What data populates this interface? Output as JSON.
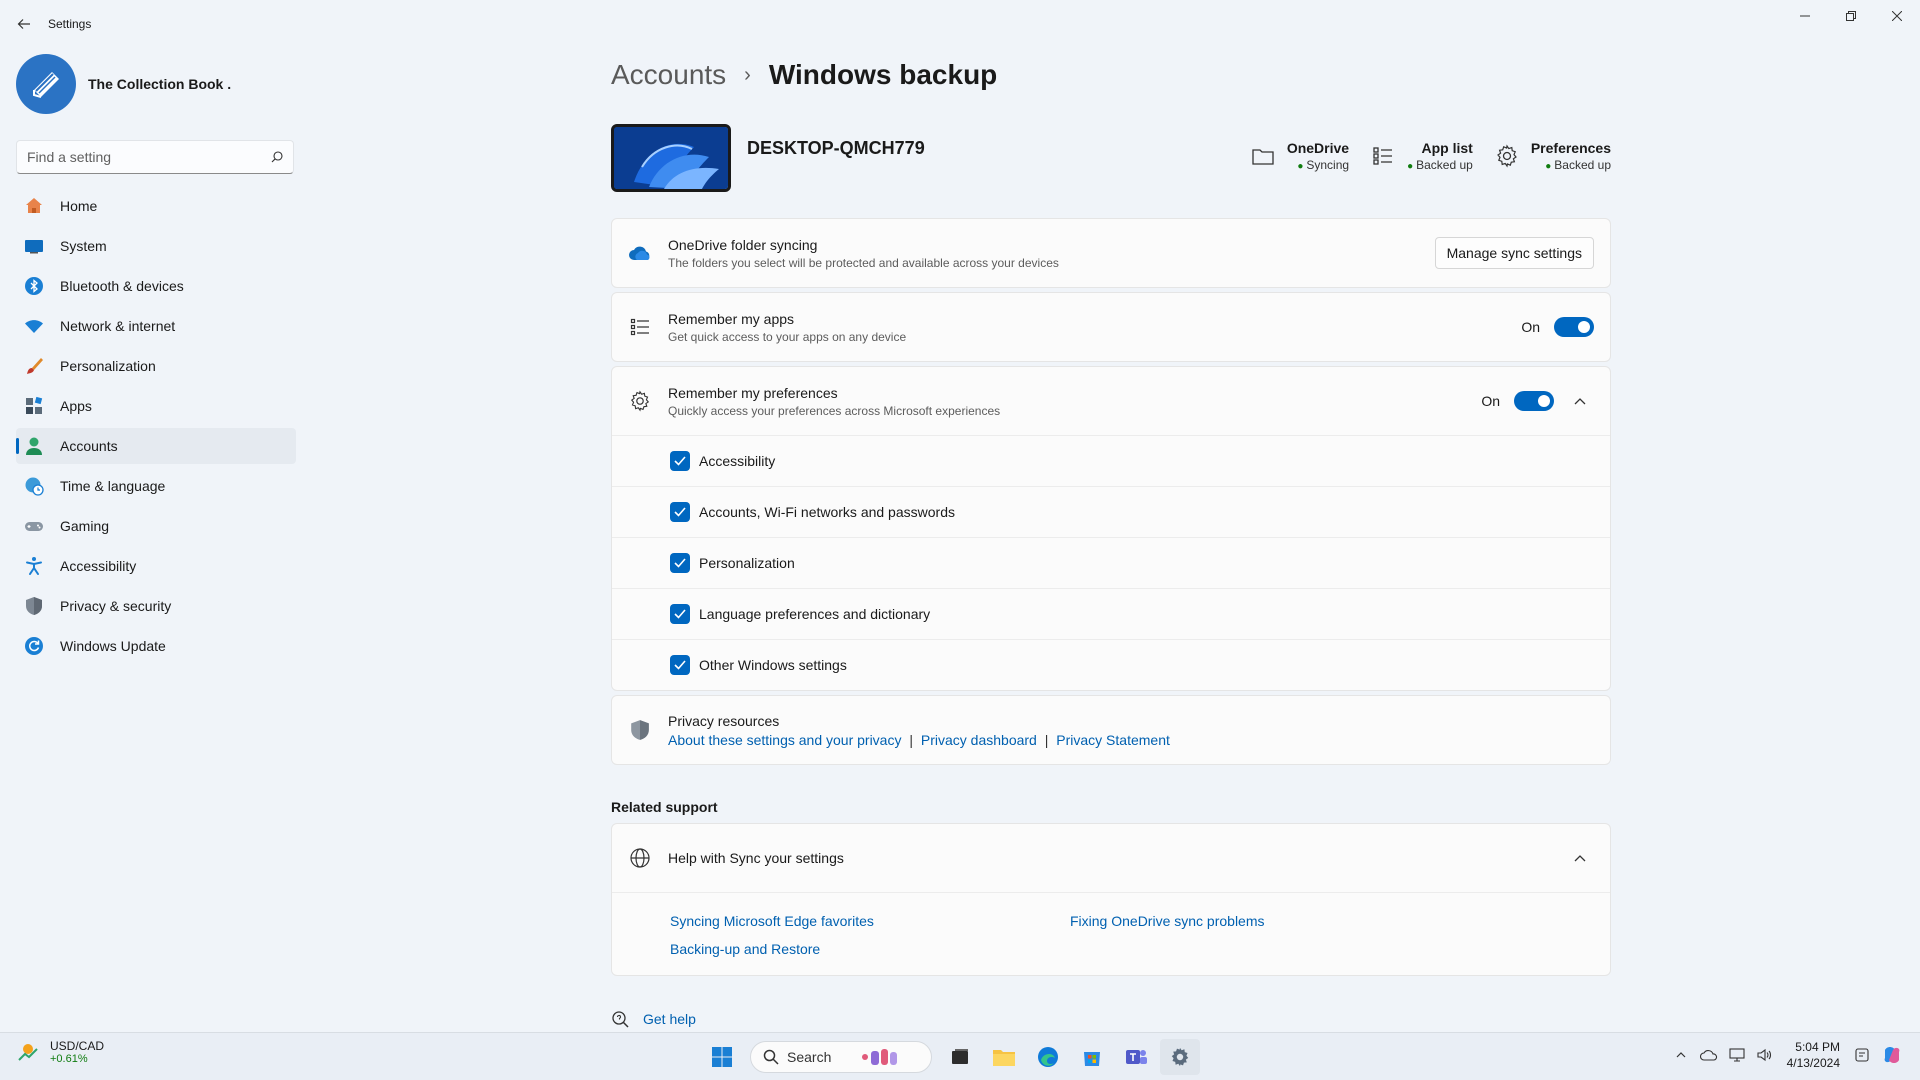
{
  "window": {
    "title": "Settings"
  },
  "profile": {
    "name": "The Collection Book ."
  },
  "search": {
    "placeholder": "Find a setting"
  },
  "sidebar": {
    "items": [
      {
        "label": "Home",
        "icon": "home-icon"
      },
      {
        "label": "System",
        "icon": "system-icon"
      },
      {
        "label": "Bluetooth & devices",
        "icon": "bluetooth-icon"
      },
      {
        "label": "Network & internet",
        "icon": "wifi-icon"
      },
      {
        "label": "Personalization",
        "icon": "brush-icon"
      },
      {
        "label": "Apps",
        "icon": "apps-icon"
      },
      {
        "label": "Accounts",
        "icon": "accounts-icon",
        "active": true
      },
      {
        "label": "Time & language",
        "icon": "globe-clock-icon"
      },
      {
        "label": "Gaming",
        "icon": "gamepad-icon"
      },
      {
        "label": "Accessibility",
        "icon": "accessibility-icon"
      },
      {
        "label": "Privacy & security",
        "icon": "shield-icon"
      },
      {
        "label": "Windows Update",
        "icon": "update-icon"
      }
    ]
  },
  "breadcrumb": {
    "parent": "Accounts",
    "current": "Windows backup"
  },
  "device": {
    "name": "DESKTOP-QMCH779",
    "status": [
      {
        "title": "OneDrive",
        "sub": "Syncing",
        "icon": "folder-icon"
      },
      {
        "title": "App list",
        "sub": "Backed up",
        "icon": "list-icon"
      },
      {
        "title": "Preferences",
        "sub": "Backed up",
        "icon": "gear-icon"
      }
    ]
  },
  "onedrive": {
    "title": "OneDrive folder syncing",
    "desc": "The folders you select will be protected and available across your devices",
    "button": "Manage sync settings"
  },
  "apps": {
    "title": "Remember my apps",
    "desc": "Get quick access to your apps on any device",
    "state": "On"
  },
  "prefs": {
    "title": "Remember my preferences",
    "desc": "Quickly access your preferences across Microsoft experiences",
    "state": "On",
    "options": [
      "Accessibility",
      "Accounts, Wi-Fi networks and passwords",
      "Personalization",
      "Language preferences and dictionary",
      "Other Windows settings"
    ]
  },
  "privacy": {
    "title": "Privacy resources",
    "link1": "About these settings and your privacy",
    "link2": "Privacy dashboard",
    "link3": "Privacy Statement",
    "sep": "|"
  },
  "support": {
    "section": "Related support",
    "title": "Help with Sync your settings",
    "links": [
      "Syncing Microsoft Edge favorites",
      "Fixing OneDrive sync problems",
      "Backing-up and Restore"
    ]
  },
  "gethelp": {
    "label": "Get help"
  },
  "taskbar": {
    "ticker": "USD/CAD",
    "change": "+0.61%",
    "search": "Search",
    "time": "5:04 PM",
    "date": "4/13/2024"
  },
  "colors": {
    "accent": "#0067c0",
    "link": "#0060b0",
    "success": "#107c10"
  }
}
